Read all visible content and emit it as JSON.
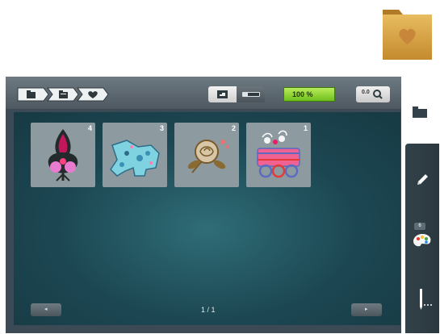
{
  "breadcrumb": {
    "items": [
      {
        "icon": "folder-icon"
      },
      {
        "icon": "folder-open-icon"
      },
      {
        "icon": "heart-icon"
      }
    ]
  },
  "toolbar": {
    "view_toggle": {
      "left_icon": "single-view-icon",
      "right_icon": "list-view-icon"
    },
    "zoom_level": "100 %",
    "zoom_button_label": "0.0"
  },
  "designs": [
    {
      "number": "4",
      "name": "paisley tree embroidery"
    },
    {
      "number": "3",
      "name": "blue floral dog embroidery"
    },
    {
      "number": "2",
      "name": "rose embroidery"
    },
    {
      "number": "1",
      "name": "flower wagon embroidery"
    }
  ],
  "pagination": {
    "indicator": "1 / 1",
    "prev_icon": "chevron-left-icon",
    "next_icon": "chevron-right-icon"
  },
  "sidebar": {
    "folder_icon": "folder-icon",
    "edit_icon": "pencil-icon",
    "color_count": "6",
    "palette_icon": "palette-icon",
    "needle_icon": "needle-icon"
  },
  "colors": {
    "accent_green": "#7ccb2a",
    "folder_gold": "#d9a545"
  }
}
